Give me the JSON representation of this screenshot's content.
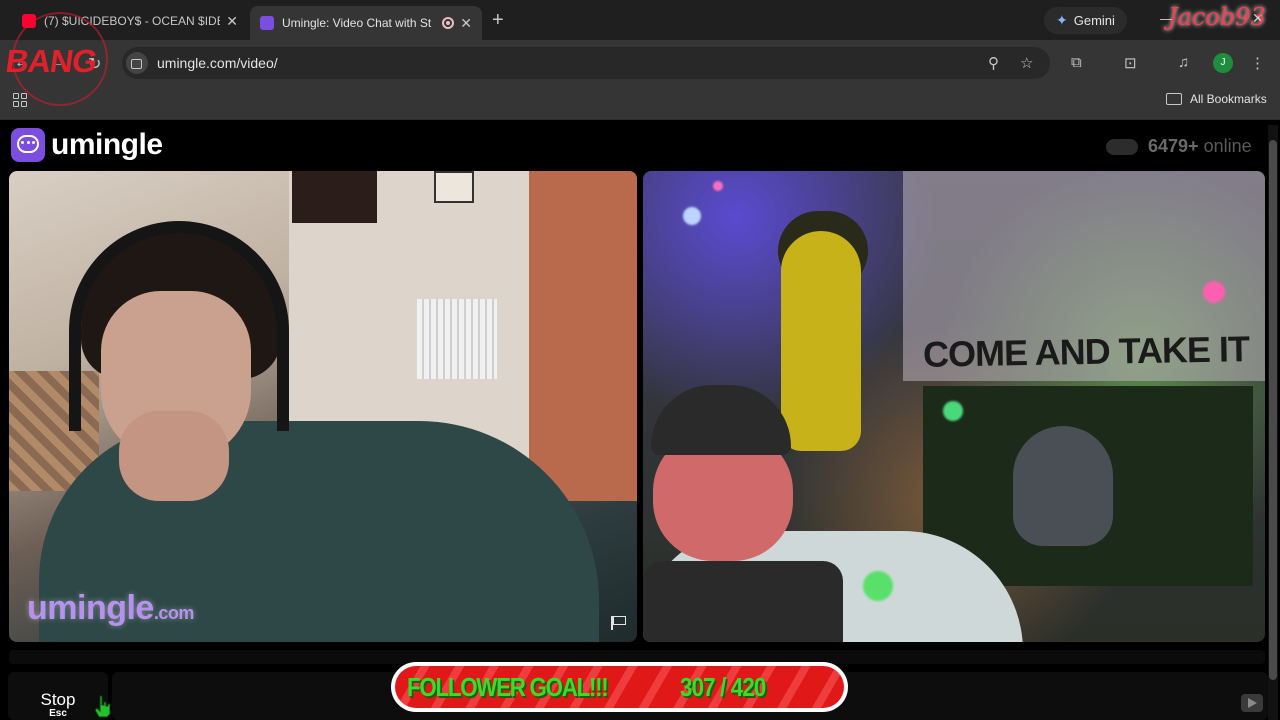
{
  "browser": {
    "tabs": [
      {
        "title": "(7) $UICIDEBOY$ - OCEAN $IDE",
        "favicon": "youtube-icon",
        "active": false
      },
      {
        "title": "Umingle: Video Chat with St",
        "favicon": "umingle-icon",
        "active": true
      }
    ],
    "gemini_label": "Gemini",
    "url": "umingle.com/video/",
    "profile_initial": "J",
    "bookmarks_label": "All Bookmarks"
  },
  "overlays": {
    "streamer_logo": "BANG",
    "streamer_name": "Jacob93"
  },
  "site": {
    "brand": "umingle",
    "online_count": "6479+",
    "online_label": "online",
    "accent_color": "#7b4ee0"
  },
  "video": {
    "watermark_main": "umingle",
    "watermark_suffix": ".com",
    "right_banner_text": "COME AND TAKE IT"
  },
  "controls": {
    "stop_label": "Stop",
    "stop_key": "Esc"
  },
  "follower_goal": {
    "label": "FOLLOWER GOAL!!!",
    "current": 307,
    "target": 420,
    "display": "307 / 420",
    "progress": 0.731
  }
}
